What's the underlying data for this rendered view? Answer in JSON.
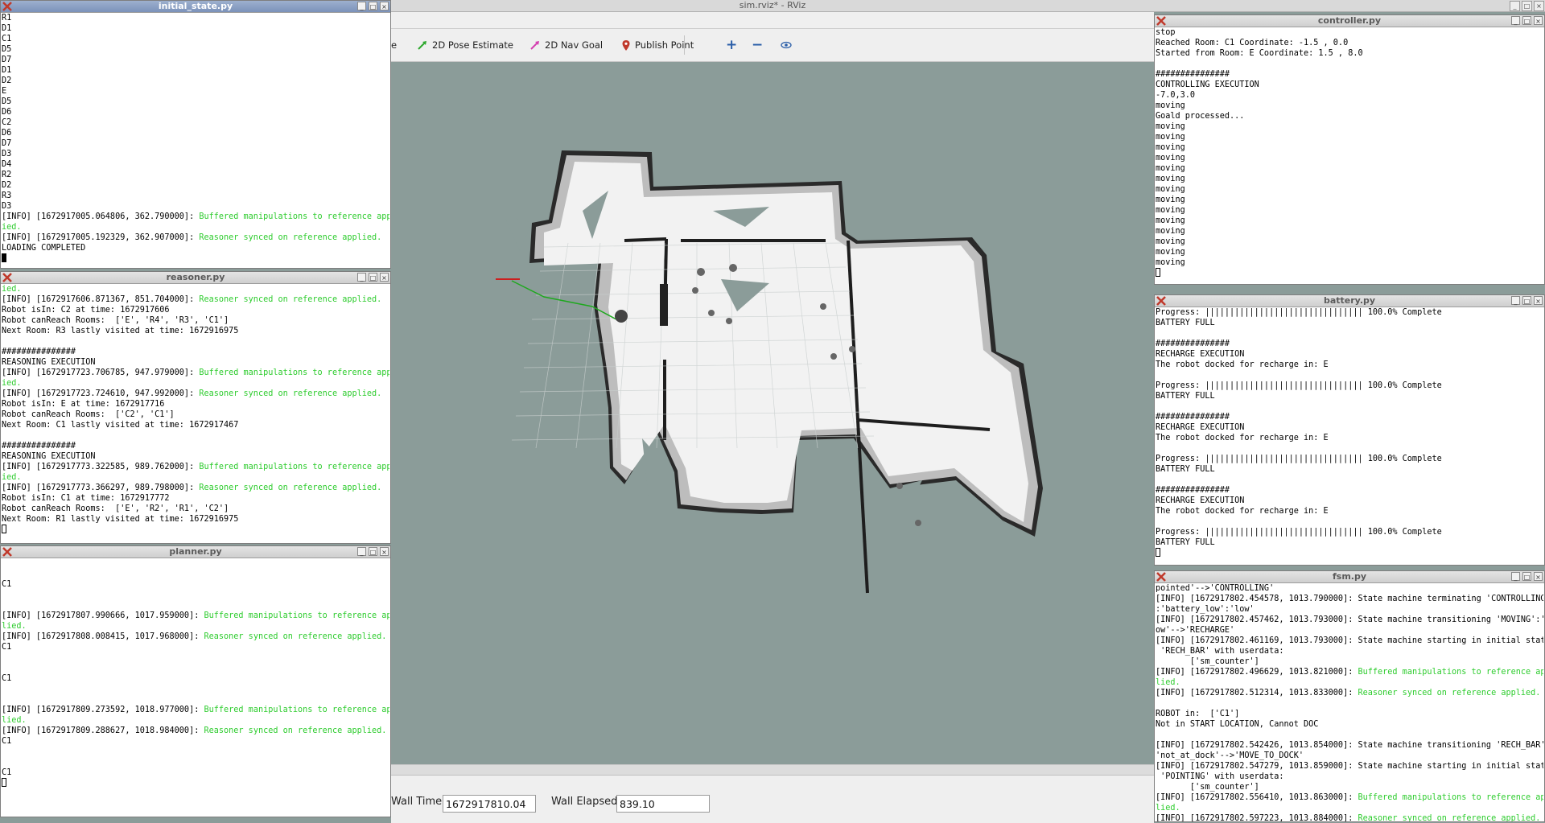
{
  "rviz": {
    "title": "sim.rviz* - RViz",
    "toolbar": {
      "partial_tool": "e",
      "pose_estimate": "2D Pose Estimate",
      "nav_goal": "2D Nav Goal",
      "publish_point": "Publish Point",
      "zoom_in": "+",
      "zoom_out": "−",
      "camera": "camera-eye-icon"
    },
    "time_panel": {
      "wall_time_label": "Wall Time:",
      "wall_time_value": "1672917810.04",
      "wall_elapsed_label": "Wall Elapsed:",
      "wall_elapsed_value": "839.10"
    }
  },
  "windows": {
    "initial_state": {
      "title": "initial_state.py",
      "lines": [
        {
          "t": "R1"
        },
        {
          "t": "D1"
        },
        {
          "t": "C1"
        },
        {
          "t": "D5"
        },
        {
          "t": "D7"
        },
        {
          "t": "D1"
        },
        {
          "t": "D2"
        },
        {
          "t": "E"
        },
        {
          "t": "D5"
        },
        {
          "t": "D6"
        },
        {
          "t": "C2"
        },
        {
          "t": "D6"
        },
        {
          "t": "D7"
        },
        {
          "t": "D3"
        },
        {
          "t": "D4"
        },
        {
          "t": "R2"
        },
        {
          "t": "D2"
        },
        {
          "t": "R3"
        },
        {
          "t": "D3"
        },
        {
          "t": "[INFO] [1672917005.064806, 362.790000]: ",
          "g": "Buffered manipulations to reference appl"
        },
        {
          "t": "",
          "g": "ied."
        },
        {
          "t": "[INFO] [1672917005.192329, 362.907000]: ",
          "g": "Reasoner synced on reference applied."
        },
        {
          "t": "LOADING COMPLETED"
        }
      ]
    },
    "reasoner": {
      "title": "reasoner.py",
      "lines": [
        {
          "t": "",
          "g": "ied."
        },
        {
          "t": "[INFO] [1672917606.871367, 851.704000]: ",
          "g": "Reasoner synced on reference applied."
        },
        {
          "t": "Robot isIn: C2 at time: 1672917606"
        },
        {
          "t": "Robot canReach Rooms:  ['E', 'R4', 'R3', 'C1']"
        },
        {
          "t": "Next Room: R3 lastly visited at time: 1672916975"
        },
        {
          "t": ""
        },
        {
          "t": "###############"
        },
        {
          "t": "REASONING EXECUTION"
        },
        {
          "t": "[INFO] [1672917723.706785, 947.979000]: ",
          "g": "Buffered manipulations to reference appl"
        },
        {
          "t": "",
          "g": "ied."
        },
        {
          "t": "[INFO] [1672917723.724610, 947.992000]: ",
          "g": "Reasoner synced on reference applied."
        },
        {
          "t": "Robot isIn: E at time: 1672917716"
        },
        {
          "t": "Robot canReach Rooms:  ['C2', 'C1']"
        },
        {
          "t": "Next Room: C1 lastly visited at time: 1672917467"
        },
        {
          "t": ""
        },
        {
          "t": "###############"
        },
        {
          "t": "REASONING EXECUTION"
        },
        {
          "t": "[INFO] [1672917773.322585, 989.762000]: ",
          "g": "Buffered manipulations to reference appl"
        },
        {
          "t": "",
          "g": "ied."
        },
        {
          "t": "[INFO] [1672917773.366297, 989.798000]: ",
          "g": "Reasoner synced on reference applied."
        },
        {
          "t": "Robot isIn: C1 at time: 1672917772"
        },
        {
          "t": "Robot canReach Rooms:  ['E', 'R2', 'R1', 'C2']"
        },
        {
          "t": "Next Room: R1 lastly visited at time: 1672916975"
        }
      ]
    },
    "planner": {
      "title": "planner.py",
      "lines": [
        {
          "t": ""
        },
        {
          "t": ""
        },
        {
          "t": "C1"
        },
        {
          "t": ""
        },
        {
          "t": ""
        },
        {
          "t": "[INFO] [1672917807.990666, 1017.959000]: ",
          "g": "Buffered manipulations to reference app"
        },
        {
          "t": "",
          "g": "lied."
        },
        {
          "t": "[INFO] [1672917808.008415, 1017.968000]: ",
          "g": "Reasoner synced on reference applied."
        },
        {
          "t": "C1"
        },
        {
          "t": ""
        },
        {
          "t": ""
        },
        {
          "t": "C1"
        },
        {
          "t": ""
        },
        {
          "t": ""
        },
        {
          "t": "[INFO] [1672917809.273592, 1018.977000]: ",
          "g": "Buffered manipulations to reference app"
        },
        {
          "t": "",
          "g": "lied."
        },
        {
          "t": "[INFO] [1672917809.288627, 1018.984000]: ",
          "g": "Reasoner synced on reference applied."
        },
        {
          "t": "C1"
        },
        {
          "t": ""
        },
        {
          "t": ""
        },
        {
          "t": "C1"
        }
      ]
    },
    "controller": {
      "title": "controller.py",
      "lines": [
        {
          "t": "stop"
        },
        {
          "t": "Reached Room: C1 Coordinate: -1.5 , 0.0"
        },
        {
          "t": "Started from Room: E Coordinate: 1.5 , 8.0"
        },
        {
          "t": ""
        },
        {
          "t": "###############"
        },
        {
          "t": "CONTROLLING EXECUTION"
        },
        {
          "t": "-7.0,3.0"
        },
        {
          "t": "moving"
        },
        {
          "t": "Goald processed..."
        },
        {
          "t": "moving"
        },
        {
          "t": "moving"
        },
        {
          "t": "moving"
        },
        {
          "t": "moving"
        },
        {
          "t": "moving"
        },
        {
          "t": "moving"
        },
        {
          "t": "moving"
        },
        {
          "t": "moving"
        },
        {
          "t": "moving"
        },
        {
          "t": "moving"
        },
        {
          "t": "moving"
        },
        {
          "t": "moving"
        },
        {
          "t": "moving"
        },
        {
          "t": "moving"
        }
      ]
    },
    "battery": {
      "title": "battery.py",
      "lines": [
        {
          "t": "Progress: |||||||||||||||||||||||||||||||| 100.0% Complete"
        },
        {
          "t": "BATTERY FULL"
        },
        {
          "t": ""
        },
        {
          "t": "###############"
        },
        {
          "t": "RECHARGE EXECUTION"
        },
        {
          "t": "The robot docked for recharge in: E"
        },
        {
          "t": ""
        },
        {
          "t": "Progress: |||||||||||||||||||||||||||||||| 100.0% Complete"
        },
        {
          "t": "BATTERY FULL"
        },
        {
          "t": ""
        },
        {
          "t": "###############"
        },
        {
          "t": "RECHARGE EXECUTION"
        },
        {
          "t": "The robot docked for recharge in: E"
        },
        {
          "t": ""
        },
        {
          "t": "Progress: |||||||||||||||||||||||||||||||| 100.0% Complete"
        },
        {
          "t": "BATTERY FULL"
        },
        {
          "t": ""
        },
        {
          "t": "###############"
        },
        {
          "t": "RECHARGE EXECUTION"
        },
        {
          "t": "The robot docked for recharge in: E"
        },
        {
          "t": ""
        },
        {
          "t": "Progress: |||||||||||||||||||||||||||||||| 100.0% Complete"
        },
        {
          "t": "BATTERY FULL"
        }
      ]
    },
    "fsm": {
      "title": "fsm.py",
      "lines": [
        {
          "t": "pointed'-->'CONTROLLING'"
        },
        {
          "t": "[INFO] [1672917802.454578, 1013.790000]: State machine terminating 'CONTROLLING'"
        },
        {
          "t": ":'battery_low':'low'"
        },
        {
          "t": "[INFO] [1672917802.457462, 1013.793000]: State machine transitioning 'MOVING':'l"
        },
        {
          "t": "ow'-->'RECHARGE'"
        },
        {
          "t": "[INFO] [1672917802.461169, 1013.793000]: State machine starting in initial state"
        },
        {
          "t": " 'RECH_BAR' with userdata: "
        },
        {
          "t": "       ['sm_counter']"
        },
        {
          "t": "[INFO] [1672917802.496629, 1013.821000]: ",
          "g": "Buffered manipulations to reference app"
        },
        {
          "t": "",
          "g": "lied."
        },
        {
          "t": "[INFO] [1672917802.512314, 1013.833000]: ",
          "g": "Reasoner synced on reference applied."
        },
        {
          "t": ""
        },
        {
          "t": "ROBOT in:  ['C1']"
        },
        {
          "t": "Not in START LOCATION, Cannot DOC"
        },
        {
          "t": ""
        },
        {
          "t": "[INFO] [1672917802.542426, 1013.854000]: State machine transitioning 'RECH_BAR':"
        },
        {
          "t": "'not_at_dock'-->'MOVE_TO_DOCK'"
        },
        {
          "t": "[INFO] [1672917802.547279, 1013.859000]: State machine starting in initial state"
        },
        {
          "t": " 'POINTING' with userdata: "
        },
        {
          "t": "       ['sm_counter']"
        },
        {
          "t": "[INFO] [1672917802.556410, 1013.863000]: ",
          "g": "Buffered manipulations to reference app"
        },
        {
          "t": "",
          "g": "lied."
        },
        {
          "t": "[INFO] [1672917802.597223, 1013.884000]: ",
          "g": "Reasoner synced on reference applied."
        }
      ]
    }
  }
}
